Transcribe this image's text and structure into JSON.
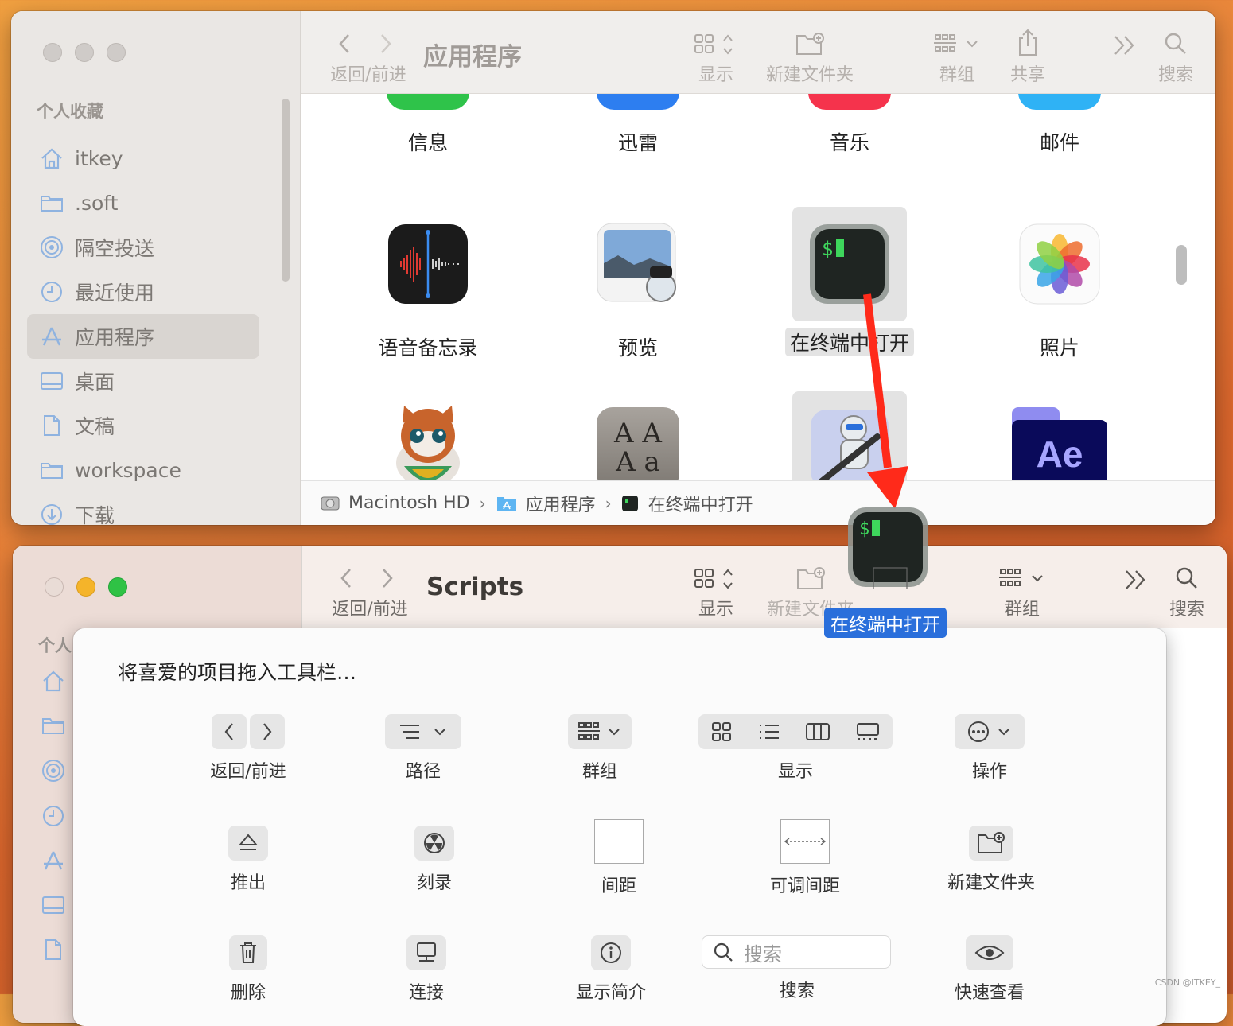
{
  "window1": {
    "traffic_lights": [
      "close",
      "minimize",
      "zoom"
    ],
    "sidebar": {
      "section_header": "个人收藏",
      "items": [
        {
          "label": "itkey",
          "icon": "home-icon"
        },
        {
          "label": ".soft",
          "icon": "folder-icon"
        },
        {
          "label": "隔空投送",
          "icon": "airdrop-icon"
        },
        {
          "label": "最近使用",
          "icon": "clock-icon"
        },
        {
          "label": "应用程序",
          "icon": "applications-icon",
          "active": true
        },
        {
          "label": "桌面",
          "icon": "desktop-icon"
        },
        {
          "label": "文稿",
          "icon": "document-icon"
        },
        {
          "label": "workspace",
          "icon": "folder-icon"
        },
        {
          "label": "下载",
          "icon": "download-icon"
        }
      ]
    },
    "toolbar": {
      "title": "应用程序",
      "back_forward_label": "返回/前进",
      "view_label": "显示",
      "new_folder_label": "新建文件夹",
      "group_label": "群组",
      "share_label": "共享",
      "search_label": "搜索"
    },
    "apps_row1": [
      "信息",
      "迅雷",
      "音乐",
      "邮件"
    ],
    "apps_row2": [
      "语音备忘录",
      "预览",
      "在终端中打开",
      "照片"
    ],
    "apps_row3_icons": [
      "cat-app-icon",
      "font-book-icon",
      "automator-icon",
      "after-effects-icon"
    ],
    "ae_text": "Ae",
    "font_book_text": [
      "A A",
      "A a"
    ],
    "pathbar": [
      "Macintosh HD",
      "应用程序",
      "在终端中打开"
    ]
  },
  "window2": {
    "sidebar": {
      "section_header": "个人"
    },
    "toolbar": {
      "title": "Scripts",
      "back_forward_label": "返回/前进",
      "view_label": "显示",
      "new_folder_label": "新建文件夹",
      "group_label": "群组",
      "search_label": "搜索"
    }
  },
  "customize_sheet": {
    "title": "将喜爱的项目拖入工具栏…",
    "row1": [
      "返回/前进",
      "路径",
      "群组",
      "显示",
      "操作"
    ],
    "row2": [
      "推出",
      "刻录",
      "间距",
      "可调间距",
      "新建文件夹"
    ],
    "row3": [
      "删除",
      "连接",
      "显示简介",
      "搜索",
      "快速查看"
    ],
    "search_placeholder": "搜索"
  },
  "drag": {
    "label": "在终端中打开",
    "terminal_prompt": "$"
  },
  "colors": {
    "arrow": "#ff2a1a",
    "selection_blue": "#2a6fdb",
    "terminal_green": "#3ed65c"
  },
  "watermark": "CSDN @ITKEY_"
}
